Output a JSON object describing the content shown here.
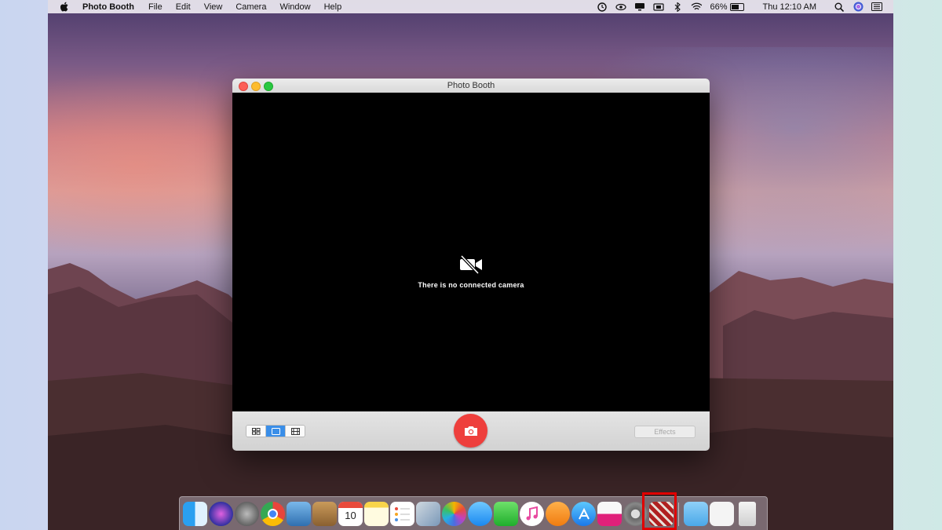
{
  "menubar": {
    "app_name": "Photo Booth",
    "menus": [
      "File",
      "Edit",
      "View",
      "Camera",
      "Window",
      "Help"
    ],
    "battery_percent": "66%",
    "battery_level": 0.66,
    "clock": "Thu 12:10 AM",
    "status_icons": [
      "timer-icon",
      "eye-icon",
      "display-icon",
      "vpn-icon",
      "bluetooth-icon",
      "wifi-icon"
    ],
    "right_icons": [
      "spotlight-search-icon",
      "siri-icon",
      "notification-center-icon"
    ]
  },
  "window": {
    "title": "Photo Booth",
    "message": "There is no connected camera",
    "effects_label": "Effects",
    "view_modes": [
      "four-up-icon",
      "single-photo-icon",
      "movie-icon"
    ],
    "active_view_mode": 1,
    "accent_color": "#ee3f3c"
  },
  "dock": {
    "apps": [
      "finder",
      "siri",
      "launchpad",
      "chrome",
      "preview",
      "contacts",
      "calendar",
      "notes",
      "reminders",
      "image-capture",
      "photos",
      "messages",
      "facetime",
      "itunes",
      "ibooks",
      "app-store",
      "photo-booth-pink",
      "system-preferences",
      "photo-booth"
    ],
    "calendar_day": "10",
    "highlighted_app": "photo-booth",
    "highlight_color": "#e00000"
  }
}
